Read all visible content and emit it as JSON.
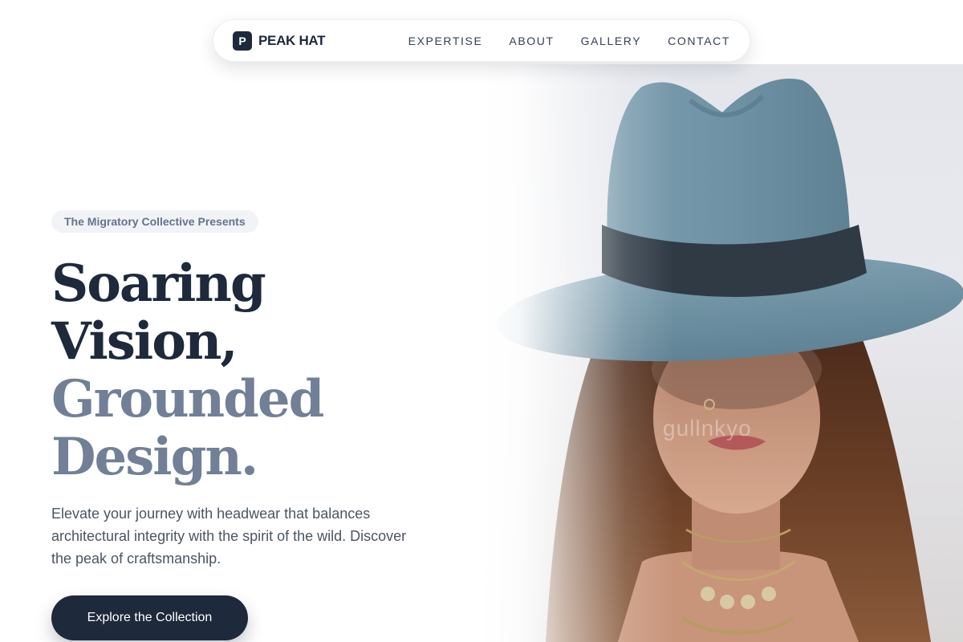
{
  "brand": {
    "mark": "P",
    "name": "PEAK HAT"
  },
  "nav": {
    "links": [
      {
        "label": "EXPERTISE"
      },
      {
        "label": "ABOUT"
      },
      {
        "label": "GALLERY"
      },
      {
        "label": "CONTACT"
      }
    ]
  },
  "hero": {
    "eyebrow": "The Migratory Collective Presents",
    "headline": {
      "line1": "Soaring",
      "line2": "Vision,",
      "line3": "Grounded",
      "line4": "Design."
    },
    "lead": "Elevate your journey with headwear that balances architectural integrity with the spirit of the wild. Discover the peak of craftsmanship.",
    "cta_label": "Explore the Collection",
    "image": {
      "subject": "woman wearing a blue felt fedora hat",
      "watermark": "gullnkyo"
    }
  },
  "colors": {
    "primary": "#1e293b",
    "muted_heading": "#718096",
    "hat": "#6f93a5",
    "hat_band": "#2f3a45",
    "hair": "#5a3522"
  }
}
